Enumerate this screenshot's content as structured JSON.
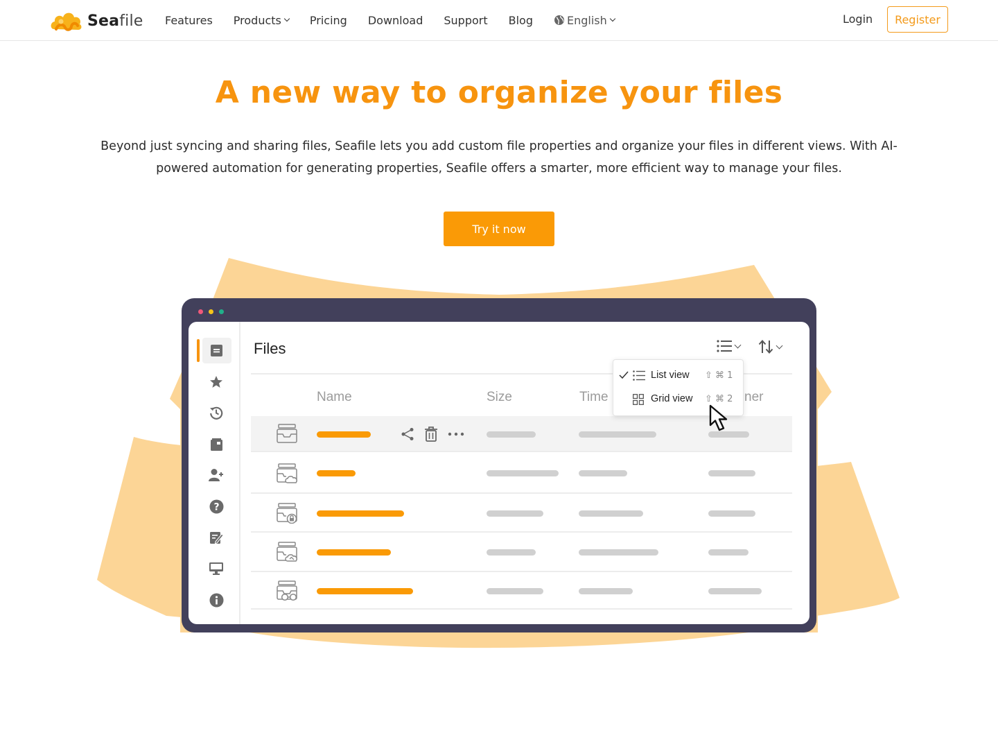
{
  "brand": {
    "name_bold": "Sea",
    "name_light": "file",
    "accent": "#f7940f",
    "logo_icon": "cloud-wave-icon"
  },
  "nav": {
    "links": [
      {
        "label": "Features"
      },
      {
        "label": "Products",
        "has_dropdown": true
      },
      {
        "label": "Pricing"
      },
      {
        "label": "Download"
      },
      {
        "label": "Support"
      },
      {
        "label": "Blog"
      }
    ],
    "language": "English",
    "login": "Login",
    "register": "Register"
  },
  "hero": {
    "title": "A new way to organize your files",
    "description": "Beyond just syncing and sharing files, Seafile lets you add custom file properties and organize your files in different views. With AI-powered automation for generating properties, Seafile offers a smarter, more efficient way to manage your files.",
    "cta": "Try it now"
  },
  "app_mock": {
    "window_dots": [
      "#f0587a",
      "#f5c41a",
      "#21b08a"
    ],
    "sidebar_icons": [
      "files-icon",
      "star-icon",
      "history-icon",
      "library-icon",
      "add-user-icon",
      "help-icon",
      "edit-icon",
      "monitor-icon",
      "info-icon"
    ],
    "title": "Files",
    "columns": [
      "Name",
      "Size",
      "Time",
      "ner"
    ],
    "view_menu": {
      "items": [
        {
          "label": "List view",
          "shortcut": "⇧ ⌘ 1",
          "checked": true,
          "icon": "list-icon"
        },
        {
          "label": "Grid view",
          "shortcut": "⇧ ⌘ 2",
          "checked": false,
          "icon": "grid-icon"
        }
      ]
    },
    "rows": [
      {
        "icon": "library-inbox-icon",
        "highlighted": true
      },
      {
        "icon": "library-cloud-icon"
      },
      {
        "icon": "library-lock-icon"
      },
      {
        "icon": "library-sync-icon"
      },
      {
        "icon": "library-glasses-icon"
      }
    ]
  }
}
